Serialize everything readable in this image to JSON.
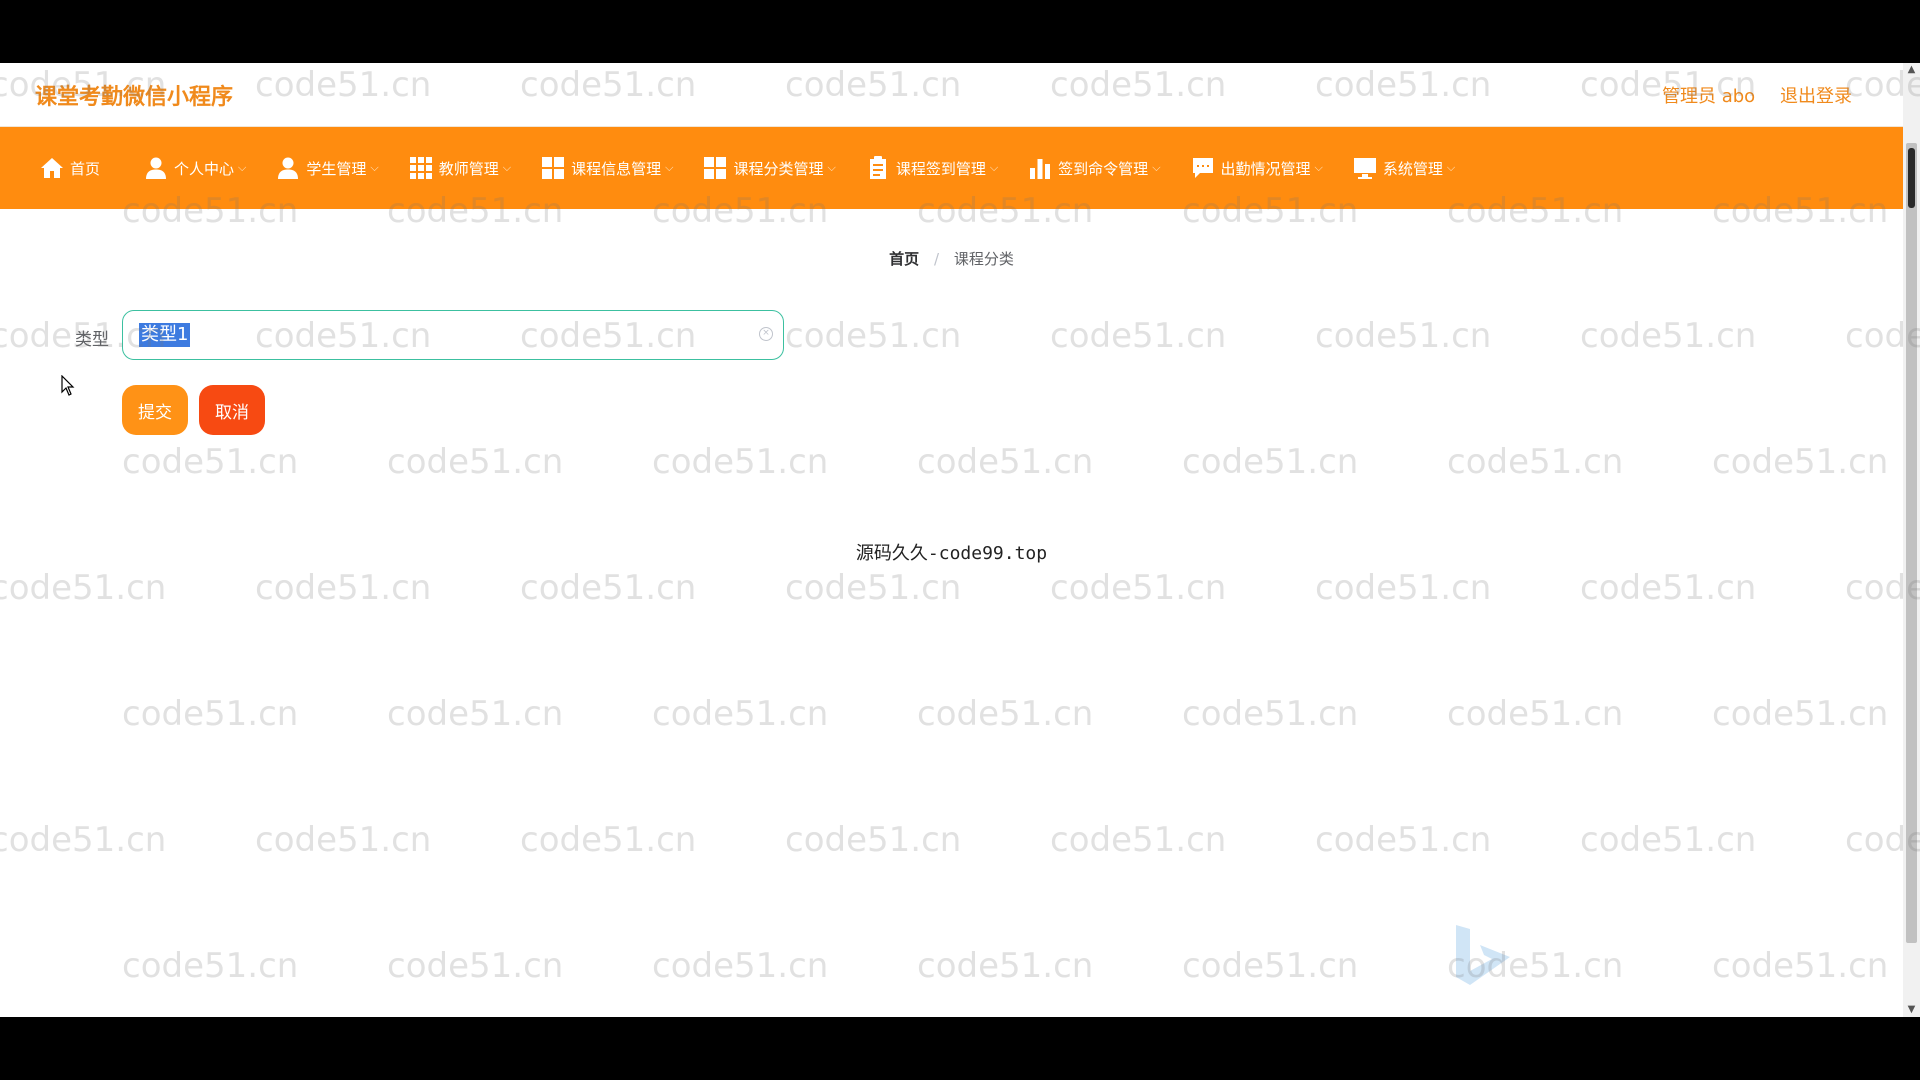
{
  "header": {
    "app_title": "课堂考勤微信小程序",
    "user": "管理员 abo",
    "logout": "退出登录"
  },
  "nav": {
    "items": [
      {
        "label": "首页",
        "icon": "home-icon",
        "dropdown": false
      },
      {
        "label": "个人中心",
        "icon": "user-icon",
        "dropdown": true
      },
      {
        "label": "学生管理",
        "icon": "user-icon",
        "dropdown": true
      },
      {
        "label": "教师管理",
        "icon": "grid-icon",
        "dropdown": true
      },
      {
        "label": "课程信息管理",
        "icon": "grid-icon",
        "dropdown": true
      },
      {
        "label": "课程分类管理",
        "icon": "grid-icon",
        "dropdown": true
      },
      {
        "label": "课程签到管理",
        "icon": "clipboard-icon",
        "dropdown": true
      },
      {
        "label": "签到命令管理",
        "icon": "bar-chart-icon",
        "dropdown": true
      },
      {
        "label": "出勤情况管理",
        "icon": "chat-icon",
        "dropdown": true
      },
      {
        "label": "系统管理",
        "icon": "monitor-icon",
        "dropdown": true
      }
    ]
  },
  "breadcrumb": {
    "home": "首页",
    "separator": "/",
    "current": "课程分类"
  },
  "form": {
    "type_label": "类型",
    "type_value": "类型1",
    "submit_label": "提交",
    "cancel_label": "取消"
  },
  "footer": {
    "text": "源码久久-code99.top"
  },
  "watermark": {
    "text": "code51.cn"
  },
  "colors": {
    "brand_orange": "#ff8c0f",
    "title_orange": "#f08a1c",
    "cancel_red": "#f74a12",
    "input_border": "#3cc0a0"
  }
}
